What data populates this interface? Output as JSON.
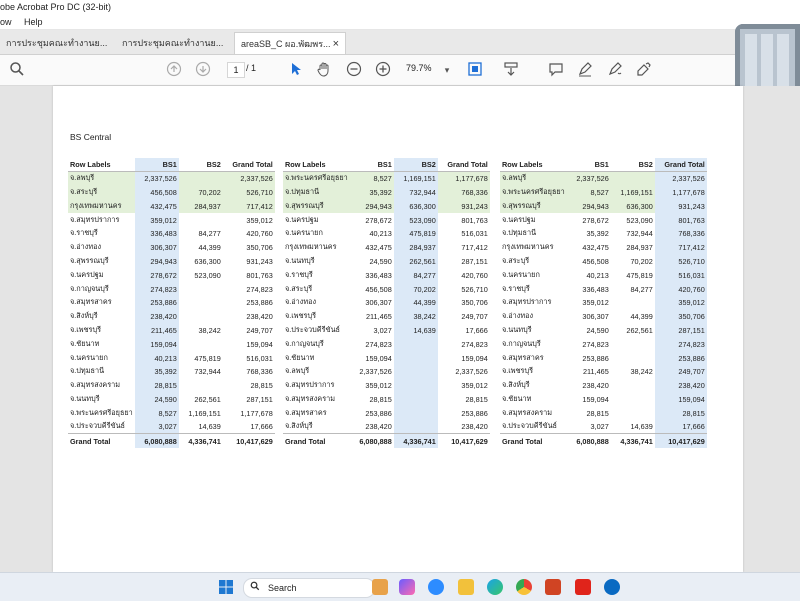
{
  "app": {
    "title": "obe Acrobat Pro DC (32-bit)",
    "menu": [
      "ow",
      "Help"
    ]
  },
  "tabs": [
    {
      "label": "การประชุมคณะทำงานย..."
    },
    {
      "label": "การประชุมคณะทำงานย..."
    },
    {
      "label": "areaSB_C ผอ.พัฒพร...",
      "close": "×"
    }
  ],
  "toolbar": {
    "page_current": "1",
    "page_total": "/ 1",
    "zoom": "79.7%",
    "icons": [
      "search-icon",
      "page-up-icon",
      "page-down-icon",
      "select-cursor-icon",
      "hand-icon",
      "zoom-out-icon",
      "zoom-in-icon",
      "fit-page-icon",
      "scroll-mode-icon",
      "comment-icon",
      "highlight-pen-icon",
      "sign-icon",
      "fill-sign-icon"
    ]
  },
  "document": {
    "section_title": "BS Central",
    "tables": [
      {
        "headers": [
          "Row Labels",
          "BS1",
          "BS2",
          "Grand Total"
        ],
        "highlight_col": 1,
        "highlight_rows": [
          0,
          1,
          2
        ],
        "rows": [
          [
            "จ.ลพบุรี",
            "2,337,526",
            "",
            "2,337,526"
          ],
          [
            "จ.สระบุรี",
            "456,508",
            "70,202",
            "526,710"
          ],
          [
            "กรุงเทพมหานคร",
            "432,475",
            "284,937",
            "717,412"
          ],
          [
            "จ.สมุทรปราการ",
            "359,012",
            "",
            "359,012"
          ],
          [
            "จ.ราชบุรี",
            "336,483",
            "84,277",
            "420,760"
          ],
          [
            "จ.อ่างทอง",
            "306,307",
            "44,399",
            "350,706"
          ],
          [
            "จ.สุพรรณบุรี",
            "294,943",
            "636,300",
            "931,243"
          ],
          [
            "จ.นครปฐม",
            "278,672",
            "523,090",
            "801,763"
          ],
          [
            "จ.กาญจนบุรี",
            "274,823",
            "",
            "274,823"
          ],
          [
            "จ.สมุทรสาคร",
            "253,886",
            "",
            "253,886"
          ],
          [
            "จ.สิงห์บุรี",
            "238,420",
            "",
            "238,420"
          ],
          [
            "จ.เพชรบุรี",
            "211,465",
            "38,242",
            "249,707"
          ],
          [
            "จ.ชัยนาท",
            "159,094",
            "",
            "159,094"
          ],
          [
            "จ.นครนายก",
            "40,213",
            "475,819",
            "516,031"
          ],
          [
            "จ.ปทุมธานี",
            "35,392",
            "732,944",
            "768,336"
          ],
          [
            "จ.สมุทรสงคราม",
            "28,815",
            "",
            "28,815"
          ],
          [
            "จ.นนทบุรี",
            "24,590",
            "262,561",
            "287,151"
          ],
          [
            "จ.พระนครศรีอยุธยา",
            "8,527",
            "1,169,151",
            "1,177,678"
          ],
          [
            "จ.ประจวบคีรีขันธ์",
            "3,027",
            "14,639",
            "17,666"
          ]
        ],
        "total": [
          "Grand Total",
          "6,080,888",
          "4,336,741",
          "10,417,629"
        ]
      },
      {
        "headers": [
          "Row Labels",
          "BS1",
          "BS2",
          "Grand Total"
        ],
        "highlight_col": 2,
        "highlight_rows": [
          0,
          1,
          2
        ],
        "rows": [
          [
            "จ.พระนครศรีอยุธยา",
            "8,527",
            "1,169,151",
            "1,177,678"
          ],
          [
            "จ.ปทุมธานี",
            "35,392",
            "732,944",
            "768,336"
          ],
          [
            "จ.สุพรรณบุรี",
            "294,943",
            "636,300",
            "931,243"
          ],
          [
            "จ.นครปฐม",
            "278,672",
            "523,090",
            "801,763"
          ],
          [
            "จ.นครนายก",
            "40,213",
            "475,819",
            "516,031"
          ],
          [
            "กรุงเทพมหานคร",
            "432,475",
            "284,937",
            "717,412"
          ],
          [
            "จ.นนทบุรี",
            "24,590",
            "262,561",
            "287,151"
          ],
          [
            "จ.ราชบุรี",
            "336,483",
            "84,277",
            "420,760"
          ],
          [
            "จ.สระบุรี",
            "456,508",
            "70,202",
            "526,710"
          ],
          [
            "จ.อ่างทอง",
            "306,307",
            "44,399",
            "350,706"
          ],
          [
            "จ.เพชรบุรี",
            "211,465",
            "38,242",
            "249,707"
          ],
          [
            "จ.ประจวบคีรีขันธ์",
            "3,027",
            "14,639",
            "17,666"
          ],
          [
            "จ.กาญจนบุรี",
            "274,823",
            "",
            "274,823"
          ],
          [
            "จ.ชัยนาท",
            "159,094",
            "",
            "159,094"
          ],
          [
            "จ.ลพบุรี",
            "2,337,526",
            "",
            "2,337,526"
          ],
          [
            "จ.สมุทรปราการ",
            "359,012",
            "",
            "359,012"
          ],
          [
            "จ.สมุทรสงคราม",
            "28,815",
            "",
            "28,815"
          ],
          [
            "จ.สมุทรสาคร",
            "253,886",
            "",
            "253,886"
          ],
          [
            "จ.สิงห์บุรี",
            "238,420",
            "",
            "238,420"
          ]
        ],
        "total": [
          "Grand Total",
          "6,080,888",
          "4,336,741",
          "10,417,629"
        ]
      },
      {
        "headers": [
          "Row Labels",
          "BS1",
          "BS2",
          "Grand Total"
        ],
        "highlight_col": 3,
        "highlight_rows": [
          0,
          1,
          2
        ],
        "rows": [
          [
            "จ.ลพบุรี",
            "2,337,526",
            "",
            "2,337,526"
          ],
          [
            "จ.พระนครศรีอยุธยา",
            "8,527",
            "1,169,151",
            "1,177,678"
          ],
          [
            "จ.สุพรรณบุรี",
            "294,943",
            "636,300",
            "931,243"
          ],
          [
            "จ.นครปฐม",
            "278,672",
            "523,090",
            "801,763"
          ],
          [
            "จ.ปทุมธานี",
            "35,392",
            "732,944",
            "768,336"
          ],
          [
            "กรุงเทพมหานคร",
            "432,475",
            "284,937",
            "717,412"
          ],
          [
            "จ.สระบุรี",
            "456,508",
            "70,202",
            "526,710"
          ],
          [
            "จ.นครนายก",
            "40,213",
            "475,819",
            "516,031"
          ],
          [
            "จ.ราชบุรี",
            "336,483",
            "84,277",
            "420,760"
          ],
          [
            "จ.สมุทรปราการ",
            "359,012",
            "",
            "359,012"
          ],
          [
            "จ.อ่างทอง",
            "306,307",
            "44,399",
            "350,706"
          ],
          [
            "จ.นนทบุรี",
            "24,590",
            "262,561",
            "287,151"
          ],
          [
            "จ.กาญจนบุรี",
            "274,823",
            "",
            "274,823"
          ],
          [
            "จ.สมุทรสาคร",
            "253,886",
            "",
            "253,886"
          ],
          [
            "จ.เพชรบุรี",
            "211,465",
            "38,242",
            "249,707"
          ],
          [
            "จ.สิงห์บุรี",
            "238,420",
            "",
            "238,420"
          ],
          [
            "จ.ชัยนาท",
            "159,094",
            "",
            "159,094"
          ],
          [
            "จ.สมุทรสงคราม",
            "28,815",
            "",
            "28,815"
          ],
          [
            "จ.ประจวบคีรีขันธ์",
            "3,027",
            "14,639",
            "17,666"
          ]
        ],
        "total": [
          "Grand Total",
          "6,080,888",
          "4,336,741",
          "10,417,629"
        ]
      }
    ]
  },
  "taskbar": {
    "search_label": "Search",
    "icons": [
      "windows-start-icon",
      "search-icon",
      "widgets-icon",
      "copilot-icon",
      "zoom-app-icon",
      "file-explorer-icon",
      "edge-browser-icon",
      "chrome-browser-icon",
      "powerpoint-icon",
      "acrobat-icon",
      "hp-icon"
    ]
  },
  "colors": {
    "row_highlight": "#e3f0d9",
    "col_highlight": "#dce9f7",
    "page_bg": "#ffffff",
    "viewer_bg": "#e4e4e4"
  }
}
